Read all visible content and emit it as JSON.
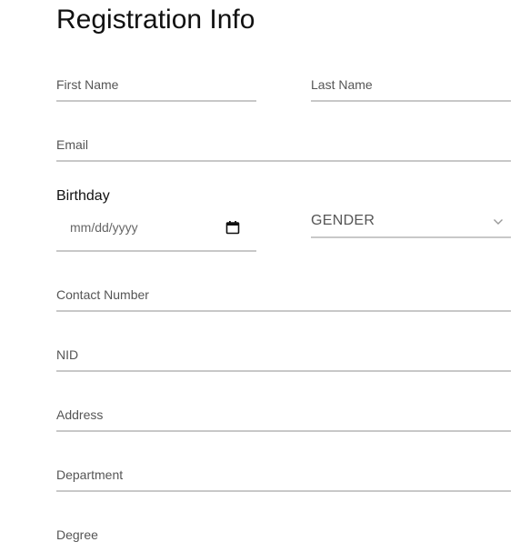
{
  "form": {
    "title": "Registration Info",
    "first_name_placeholder": "First Name",
    "last_name_placeholder": "Last Name",
    "email_placeholder": "Email",
    "birthday_label": "Birthday",
    "birthday_placeholder": "mm/dd/yyyy",
    "gender_select_value": "GENDER",
    "contact_placeholder": "Contact Number",
    "nid_placeholder": "NID",
    "address_placeholder": "Address",
    "department_placeholder": "Department",
    "degree_placeholder": "Degree"
  },
  "icons": {
    "calendar": "calendar-icon",
    "dropdown": "chevron-down-icon"
  },
  "colors": {
    "underline": "#c8c8c8",
    "placeholder_text": "#555555",
    "title_text": "#111111"
  }
}
